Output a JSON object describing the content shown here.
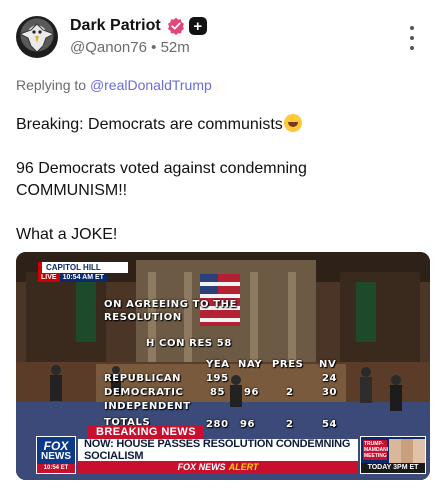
{
  "author": {
    "display_name": "Dark Patriot",
    "handle": "@Qanon76",
    "separator": "•",
    "time_ago": "52m"
  },
  "reply": {
    "prefix": "Replying to",
    "mention": "@realDonaldTrump"
  },
  "post": {
    "line1": "Breaking: Democrats are communists",
    "line2": "96 Democrats voted against condemning",
    "line3": "COMMUNISM!!",
    "line4": "What a JOKE!"
  },
  "media": {
    "capitol_hill": "CAPITOL HILL",
    "live": "LIVE",
    "clock": "10:54 AM ET",
    "vote_line1": "ON AGREEING TO THE",
    "vote_line2": "RESOLUTION",
    "measure": "H CON RES 58",
    "col_yea": "YEA",
    "col_nay": "NAY",
    "col_pres": "PRES",
    "col_nv": "NV",
    "row_rep": "REPUBLICAN",
    "rep_yea": "195",
    "rep_nv": "24",
    "row_dem": "DEMOCRATIC",
    "dem_yea": "85",
    "dem_nay": "96",
    "dem_pres": "2",
    "dem_nv": "30",
    "row_ind": "INDEPENDENT",
    "row_totals": "TOTALS",
    "tot_yea": "280",
    "tot_nay": "96",
    "tot_pres": "2",
    "tot_nv": "54",
    "breaking": "BREAKING NEWS",
    "fox1": "FOX",
    "fox2": "NEWS",
    "fox_time": "10:54 ET",
    "headline": "NOW: HOUSE PASSES RESOLUTION CONDEMNING SOCIALISM",
    "alert_brand": "FOX NEWS",
    "alert_word": "ALERT",
    "promo_tag": "TRUMP-MAMDANI MEETING",
    "promo_time": "TODAY 3PM ET"
  },
  "colors": {
    "link": "#6b6be0",
    "verified": "#e0457b",
    "fox_red": "#c8102e",
    "fox_blue": "#0b3a8a"
  },
  "icons": [
    "eagle-avatar",
    "verified-badge-icon",
    "plus-badge-icon",
    "more-options-icon",
    "rofl-emoji"
  ]
}
